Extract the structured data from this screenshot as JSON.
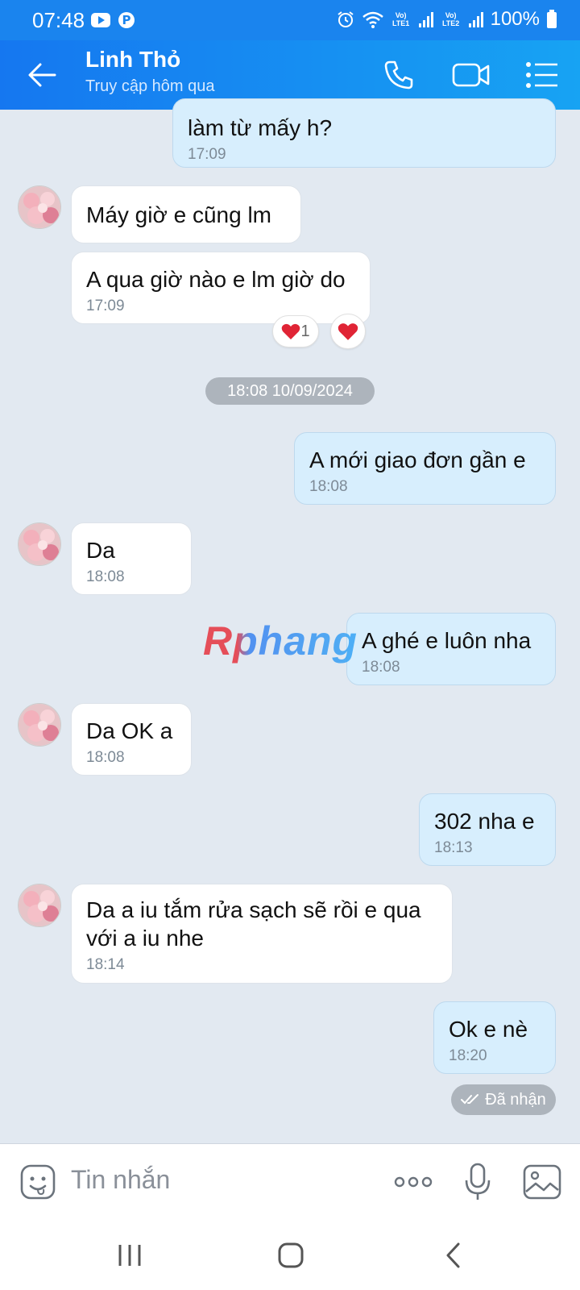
{
  "status_bar": {
    "time": "07:48",
    "app_icons": [
      "youtube-icon",
      "pinterest-icon"
    ],
    "sim1_label": "Vo) LTE1",
    "sim2_label": "Vo) LTE2",
    "battery": "100%"
  },
  "header": {
    "contact_name": "Linh Thỏ",
    "contact_status": "Truy cập hôm qua",
    "icons": [
      "back-arrow-icon",
      "phone-icon",
      "video-camera-icon",
      "list-menu-icon"
    ]
  },
  "messages": [
    {
      "side": "out",
      "text": "làm từ mấy h?",
      "time": "17:09"
    },
    {
      "side": "in",
      "text": "Máy giờ e cũng lm",
      "time": ""
    },
    {
      "side": "in",
      "text": "A qua giờ nào e lm giờ do",
      "time": "17:09",
      "reaction_count": "1"
    },
    {
      "side": "out",
      "text": "A mới giao đơn gần e",
      "time": "18:08"
    },
    {
      "side": "in",
      "text": "Da",
      "time": "18:08"
    },
    {
      "side": "out",
      "text": "A ghé e luôn nha",
      "time": "18:08"
    },
    {
      "side": "in",
      "text": "Da OK a",
      "time": "18:08"
    },
    {
      "side": "out",
      "text": "302 nha e",
      "time": "18:13"
    },
    {
      "side": "in",
      "text": "Da a iu tắm rửa sạch sẽ rồi e qua với a iu nhe",
      "time": "18:14"
    },
    {
      "side": "out",
      "text": "Ok e nè",
      "time": "18:20"
    }
  ],
  "date_separator": "18:08 10/09/2024",
  "watermark": "Rphang",
  "delivered_label": "Đã nhận",
  "input": {
    "placeholder": "Tin nhắn",
    "icons": [
      "emoji-icon",
      "more-dots-icon",
      "microphone-icon",
      "image-icon"
    ]
  },
  "colors": {
    "header_start": "#1577f0",
    "header_end": "#17a3f3",
    "chat_background": "#e2e9f1",
    "outgoing_bubble": "#d7eefd",
    "incoming_bubble": "#ffffff"
  }
}
